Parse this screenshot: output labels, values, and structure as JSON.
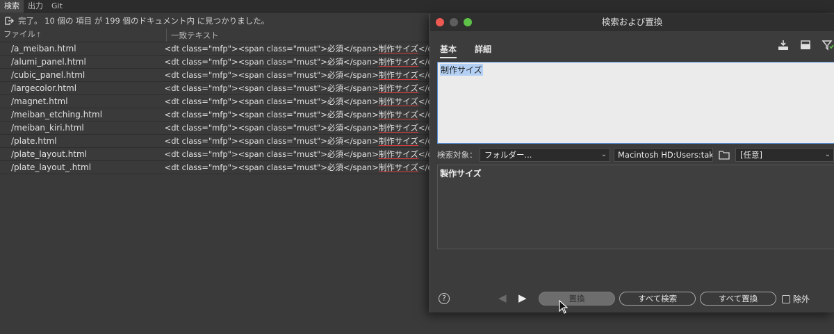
{
  "panel_tabs": [
    "検索",
    "出力",
    "Git"
  ],
  "status": {
    "text": "完了。 10 個の 項目 が 199 個のドキュメント内 に見つかりました。"
  },
  "results": {
    "columns": {
      "file": "ファイル",
      "text": "一致テキスト"
    },
    "rows": [
      {
        "file": "/a_meiban.html",
        "prefix": "<dt class=\"mfp\"><span class=\"must\">必須</span>",
        "match": "制作サイズ",
        "suffix": "</dt>"
      },
      {
        "file": "/alumi_panel.html",
        "prefix": "<dt class=\"mfp\"><span class=\"must\">必須</span>",
        "match": "制作サイズ",
        "suffix": "</dt>"
      },
      {
        "file": "/cubic_panel.html",
        "prefix": "<dt class=\"mfp\"><span class=\"must\">必須</span>",
        "match": "制作サイズ",
        "suffix": "</dt>"
      },
      {
        "file": "/largecolor.html",
        "prefix": "<dt class=\"mfp\"><span class=\"must\">必須</span>",
        "match": "制作サイズ",
        "suffix": "</dt>"
      },
      {
        "file": "/magnet.html",
        "prefix": "<dt class=\"mfp\"><span class=\"must\">必須</span>",
        "match": "制作サイズ",
        "suffix": "</dt>"
      },
      {
        "file": "/meiban_etching.html",
        "prefix": "<dt class=\"mfp\"><span class=\"must\">必須</span>",
        "match": "制作サイズ",
        "suffix": "</dt>"
      },
      {
        "file": "/meiban_kiri.html",
        "prefix": "<dt class=\"mfp\"><span class=\"must\">必須</span>",
        "match": "制作サイズ",
        "suffix": "</dt>"
      },
      {
        "file": "/plate.html",
        "prefix": "<dt class=\"mfp\"><span class=\"must\">必須</span>",
        "match": "制作サイズ",
        "suffix": "</dt>"
      },
      {
        "file": "/plate_layout.html",
        "prefix": "<dt class=\"mfp\"><span class=\"must\">必須</span>",
        "match": "制作サイズ",
        "suffix": "</dt>"
      },
      {
        "file": "/plate_layout_.html",
        "prefix": "<dt class=\"mfp\"><span class=\"must\">必須</span>",
        "match": "制作サイズ",
        "suffix": "</dt>"
      }
    ]
  },
  "dialog": {
    "title": "検索および置換",
    "tabs": [
      "基本",
      "詳細"
    ],
    "find_text": "制作サイズ",
    "scope_label": "検索対象：",
    "scope_value": "フォルダー...",
    "path": "Macintosh HD:Users:taku",
    "filter_value": "[任意]",
    "replace_text": "製作サイズ",
    "buttons": {
      "replace": "置換",
      "find_all": "すべて検索",
      "replace_all": "すべて置換"
    },
    "exclude_label": "除外",
    "help_glyph": "?"
  },
  "colors": {
    "find_highlight": "#b3d0f4",
    "match_underline": "#d23b3b",
    "close": "#ee5a52",
    "zoom": "#5ec148"
  }
}
